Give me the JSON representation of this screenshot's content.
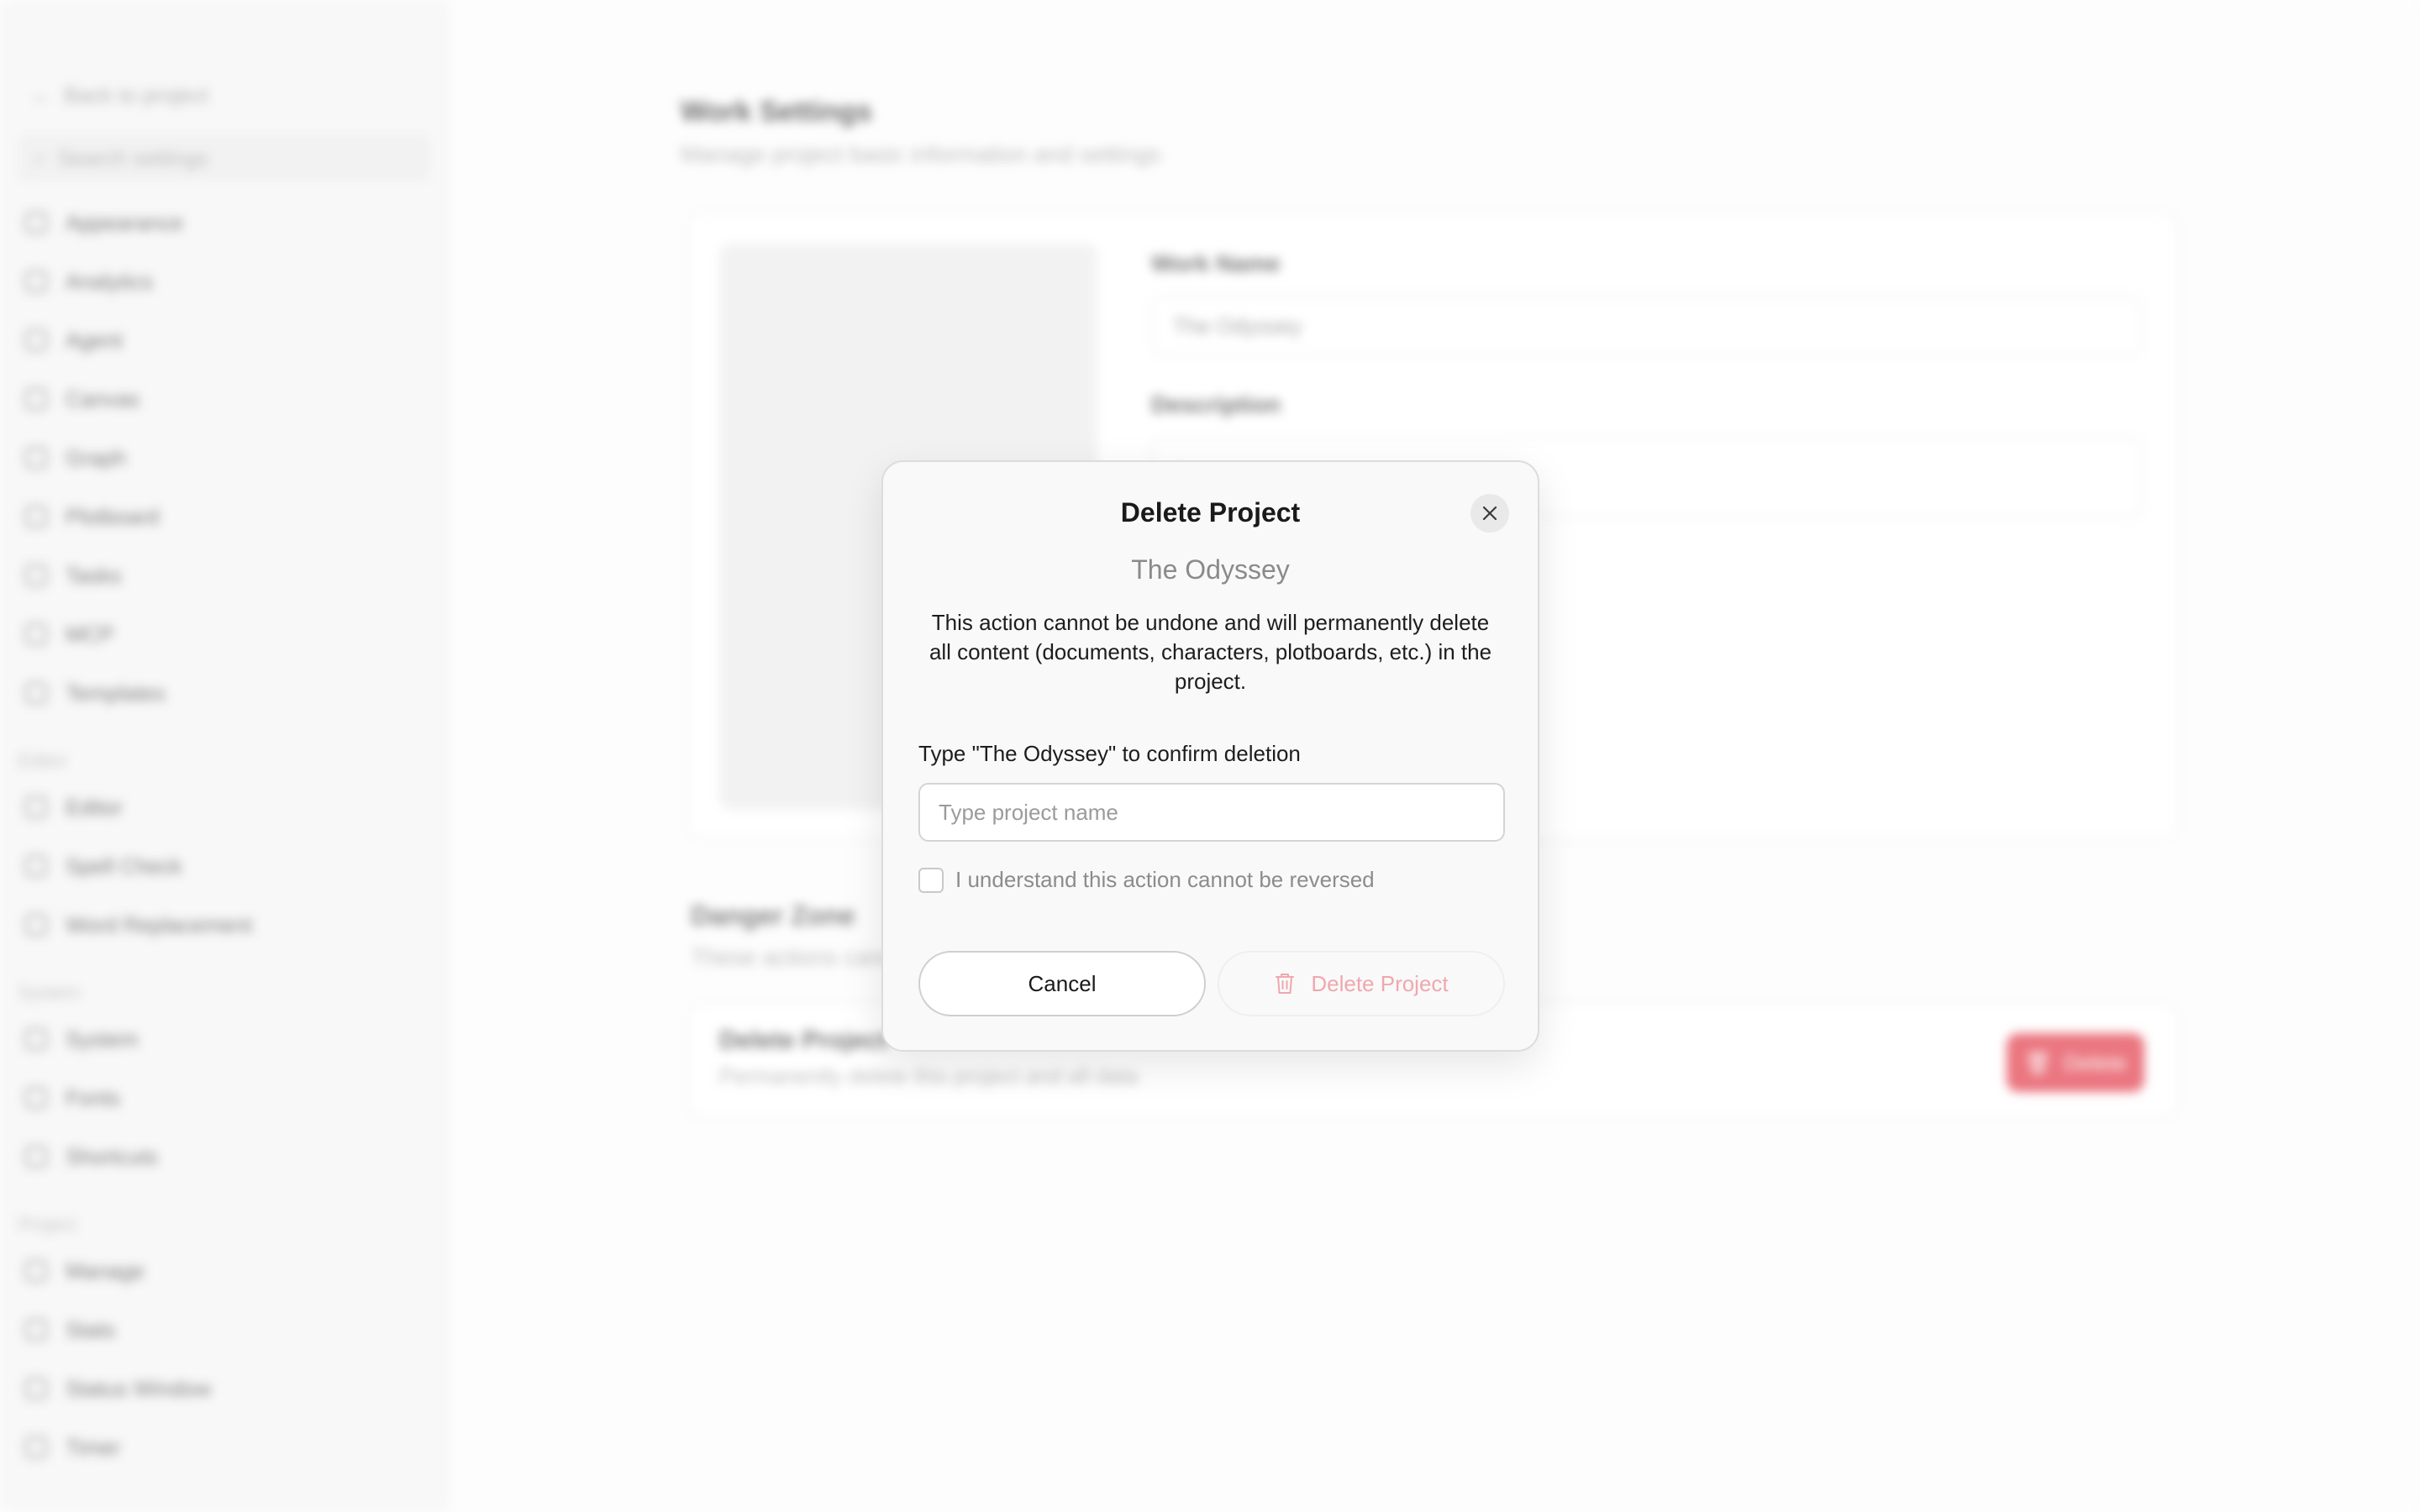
{
  "background": {
    "sidebar": {
      "back_label": "Back to project",
      "search_placeholder": "Search settings",
      "items_top": [
        {
          "label": "Appearance"
        },
        {
          "label": "Analytics"
        },
        {
          "label": "Agent"
        },
        {
          "label": "Canvas"
        },
        {
          "label": "Graph"
        },
        {
          "label": "Plotboard"
        },
        {
          "label": "Tasks"
        },
        {
          "label": "MCP"
        },
        {
          "label": "Templates"
        }
      ],
      "group_editor": "Editor",
      "items_editor": [
        {
          "label": "Editor"
        },
        {
          "label": "Spell Check"
        },
        {
          "label": "Word Replacement"
        }
      ],
      "group_system": "System",
      "items_system": [
        {
          "label": "System"
        },
        {
          "label": "Fonts"
        },
        {
          "label": "Shortcuts"
        }
      ],
      "group_project": "Project",
      "items_project": [
        {
          "label": "Manage"
        },
        {
          "label": "Stats"
        },
        {
          "label": "Status Window"
        },
        {
          "label": "Timer"
        }
      ]
    },
    "main": {
      "title": "Work Settings",
      "subtitle": "Manage project basic information and settings",
      "work_name_label": "Work Name",
      "work_name_value": "The Odyssey",
      "description_label": "Description",
      "description_placeholder": "Enter project description",
      "danger_zone_title": "Danger Zone",
      "danger_zone_subtitle": "These actions cannot be undone",
      "delete_project_title": "Delete Project",
      "delete_project_subtitle": "Permanently delete this project and all data",
      "delete_button_label": "Delete"
    }
  },
  "modal": {
    "title": "Delete Project",
    "project_name": "The Odyssey",
    "description": "This action cannot be undone and will permanently delete all content (documents, characters, plotboards, etc.) in the project.",
    "confirm_label": "Type \"The Odyssey\" to confirm deletion",
    "input_placeholder": "Type project name",
    "checkbox_label": "I understand this action cannot be reversed",
    "cancel_label": "Cancel",
    "delete_label": "Delete Project"
  },
  "colors": {
    "danger": "#e02d3c",
    "danger_disabled_text": "#f0a7ae"
  }
}
